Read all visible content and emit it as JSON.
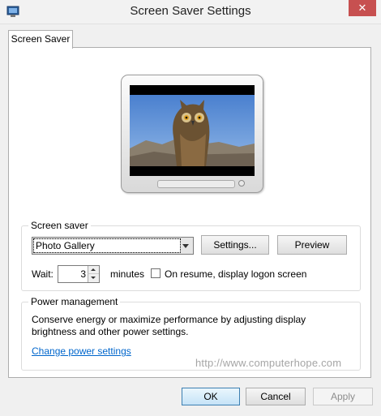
{
  "window": {
    "title": "Screen Saver Settings",
    "close_glyph": "✕"
  },
  "tabs": [
    {
      "label": "Screen Saver",
      "selected": true
    }
  ],
  "preview": {
    "image": "owl-photo",
    "screen_background": "#000000",
    "sky_color": "#5c8fd6"
  },
  "screensaver": {
    "group_label": "Screen saver",
    "selected": "Photo Gallery",
    "settings_label": "Settings...",
    "preview_label": "Preview",
    "wait_label": "Wait:",
    "wait_value": "3",
    "minutes_label": "minutes",
    "resume_label": "On resume, display logon screen",
    "resume_checked": false
  },
  "power": {
    "group_label": "Power management",
    "description": "Conserve energy or maximize performance by adjusting display brightness and other power settings.",
    "link_label": "Change power settings"
  },
  "watermark": "http://www.computerhope.com",
  "footer": {
    "ok_label": "OK",
    "cancel_label": "Cancel",
    "apply_label": "Apply",
    "apply_enabled": false
  },
  "colors": {
    "link": "#0066cc",
    "close_button": "#c75050",
    "default_button_border": "#3c7fb1"
  }
}
